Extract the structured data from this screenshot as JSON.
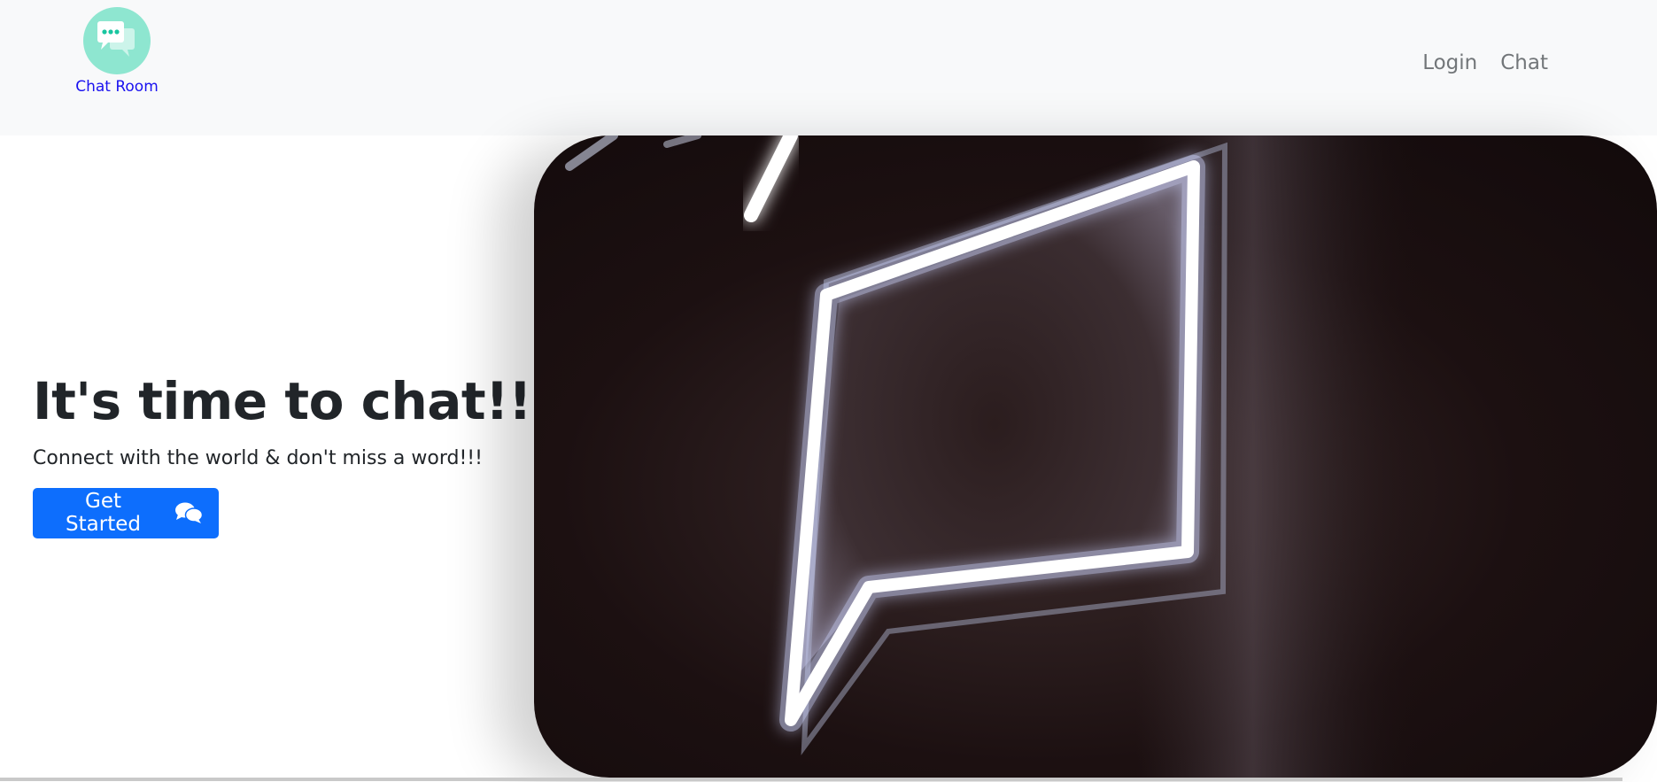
{
  "navbar": {
    "brand_label": "Chat Room",
    "brand_icon": "chat-bubbles-icon",
    "links": [
      {
        "label": "Login"
      },
      {
        "label": "Chat"
      }
    ]
  },
  "hero": {
    "title": "It's time to chat!!!",
    "subtitle": "Connect with the world & don't miss a word!!!",
    "cta_label": "Get Started",
    "cta_icon": "comments-icon",
    "image": "neon-speech-bubble-photo"
  },
  "colors": {
    "navbar_bg": "#f8f9fa",
    "brand_logo_bg": "#8ee6d0",
    "brand_text": "#1a12f0",
    "nav_link": "#727679",
    "primary": "#0d6efd",
    "heading": "#212529"
  }
}
